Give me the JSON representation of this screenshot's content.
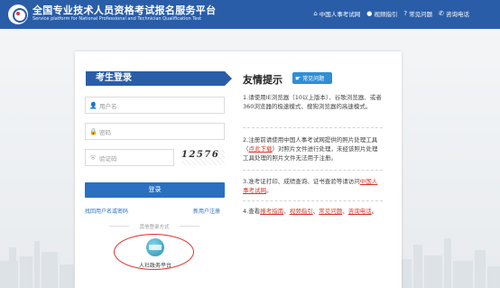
{
  "header": {
    "title": "全国专业技术人员资格考试报名服务平台",
    "subtitle": "Service platform for National Professional and Technician Qualification Test",
    "nav": [
      {
        "icon": "home-icon",
        "label": "中国人事考试网"
      },
      {
        "icon": "video-icon",
        "label": "视频指引"
      },
      {
        "icon": "question-icon",
        "label": "常见问题"
      },
      {
        "icon": "phone-icon",
        "label": "咨询电话"
      }
    ]
  },
  "login": {
    "heading": "考生登录",
    "username_placeholder": "用户名",
    "password_placeholder": "密码",
    "captcha_placeholder": "验证码",
    "captcha_text": "12576",
    "login_button": "登录",
    "forgot_link": "找回用户名或密码",
    "register_link": "新用户注册",
    "other_login": "其他登录方式",
    "service_label": "人社政务平台"
  },
  "tips": {
    "title": "友情提示",
    "faq_tag": "常见问题",
    "t1": "1.请使用IE浏览器（10以上版本）、谷歌浏览器、或者360浏览器的极速模式、搜狗浏览器的高速模式。",
    "t2_a": "2.注册前请使用中国人事考试网提供的照片处理工具（",
    "t2_link": "点此下载",
    "t2_b": "）对照片文件进行处理，未经该照片处理工具处理的照片文件无法用于注册。",
    "t3_a": "3.准考证打印、成绩查询、证书查验等请访问",
    "t3_link": "中国人事考试网",
    "t3_b": "。",
    "t4_a": "4.查看",
    "t4_l1": "报考指南",
    "t4_l2": "视频指引",
    "t4_l3": "常见问题",
    "t4_l4": "咨询电话",
    "sep": "、",
    "end": "。"
  },
  "colors": {
    "brand_blue": "#2a5da8",
    "button_blue": "#2a6fc0",
    "link_red": "#d9352a",
    "highlight_ring": "#e0302a"
  }
}
